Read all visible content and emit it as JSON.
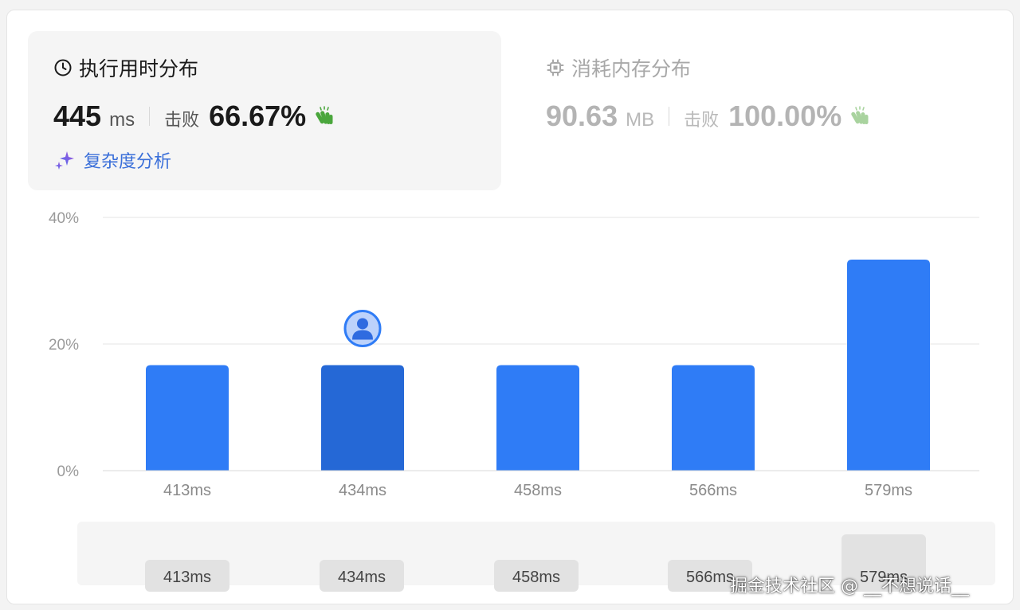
{
  "runtime": {
    "title": "执行用时分布",
    "value": "445",
    "unit": "ms",
    "beat_label": "击败",
    "beat_value": "66.67%",
    "complexity_link": "复杂度分析"
  },
  "memory": {
    "title": "消耗内存分布",
    "value": "90.63",
    "unit": "MB",
    "beat_label": "击败",
    "beat_value": "100.00%"
  },
  "chart_data": {
    "type": "bar",
    "categories": [
      "413ms",
      "434ms",
      "458ms",
      "566ms",
      "579ms"
    ],
    "values": [
      16.67,
      16.67,
      16.67,
      16.67,
      33.33
    ],
    "ylim": [
      0,
      40
    ],
    "yticks": [
      "0%",
      "20%",
      "40%"
    ],
    "ytick_values": [
      0,
      20,
      40
    ],
    "highlight_index": 1,
    "grid": true
  },
  "brush": {
    "labels": [
      "413ms",
      "434ms",
      "458ms",
      "566ms",
      "579ms"
    ]
  },
  "colors": {
    "bar": "#2f7cf6",
    "bar_highlight": "#2568d6",
    "clap_active": "#4aa63c",
    "clap_muted": "#a9d39f",
    "link": "#3a6fd9"
  },
  "icons": {
    "runtime": "clock-icon",
    "memory": "chip-icon",
    "beat": "clapping-hands-icon",
    "complexity": "sparkle-icon",
    "user_marker": "user-avatar-icon"
  },
  "watermark": "掘金技术社区 @ __不想说话__"
}
